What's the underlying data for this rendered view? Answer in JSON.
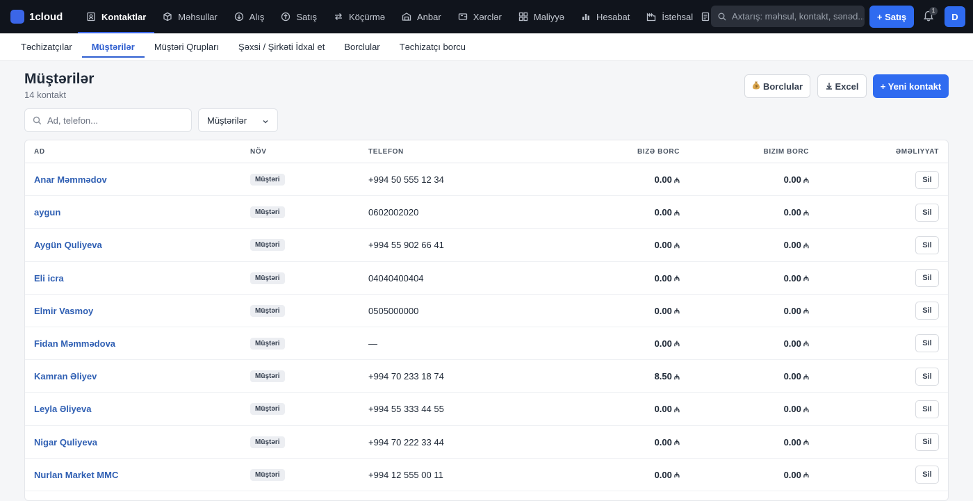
{
  "app": {
    "name": "1cloud"
  },
  "nav": [
    {
      "label": "Kontaktlar",
      "icon": "contacts-icon",
      "active": true
    },
    {
      "label": "Məhsullar",
      "icon": "box-icon"
    },
    {
      "label": "Alış",
      "icon": "arrow-down-circle-icon"
    },
    {
      "label": "Satış",
      "icon": "arrow-up-circle-icon"
    },
    {
      "label": "Köçürmə",
      "icon": "transfer-icon"
    },
    {
      "label": "Anbar",
      "icon": "warehouse-icon"
    },
    {
      "label": "Xərclər",
      "icon": "wallet-icon"
    },
    {
      "label": "Maliyyə",
      "icon": "grid-icon"
    },
    {
      "label": "Hesabat",
      "icon": "bar-chart-icon"
    },
    {
      "label": "İstehsal",
      "icon": "factory-icon"
    }
  ],
  "topbar": {
    "search_placeholder": "Axtarış: məhsul, kontakt, sənəd...",
    "sale_button": "+ Satış",
    "notifications_count": "1",
    "avatar_initial": "D"
  },
  "subtabs": [
    {
      "label": "Təchizatçılar"
    },
    {
      "label": "Müştərilər",
      "active": true
    },
    {
      "label": "Müştəri Qrupları"
    },
    {
      "label": "Şəxsi / Şirkəti İdxal et"
    },
    {
      "label": "Borclular"
    },
    {
      "label": "Təchizatçı borcu"
    }
  ],
  "page": {
    "title": "Müştərilər",
    "subtitle": "14 kontakt",
    "buttons": {
      "debtors": "Borclular",
      "debtors_icon": "money-bag-icon",
      "excel": "Excel",
      "new_contact": "+ Yeni kontakt"
    }
  },
  "filters": {
    "search_placeholder": "Ad, telefon...",
    "type_selected": "Müştərilər"
  },
  "table": {
    "columns": {
      "name": "Ad",
      "type": "Növ",
      "phone": "Telefon",
      "owed_to_us": "Bizə borc",
      "our_debt": "Bizim borc",
      "actions": "Əməliyyat"
    },
    "currency": "₼",
    "delete_label": "Sil",
    "rows": [
      {
        "name": "Anar Məmmədov",
        "type": "Müştəri",
        "phone": "+994 50 555 12 34",
        "owed_to_us": "0.00",
        "our_debt": "0.00"
      },
      {
        "name": "aygun",
        "type": "Müştəri",
        "phone": "0602002020",
        "owed_to_us": "0.00",
        "our_debt": "0.00"
      },
      {
        "name": "Aygün Quliyeva",
        "type": "Müştəri",
        "phone": "+994 55 902 66 41",
        "owed_to_us": "0.00",
        "our_debt": "0.00"
      },
      {
        "name": "Eli icra",
        "type": "Müştəri",
        "phone": "04040400404",
        "owed_to_us": "0.00",
        "our_debt": "0.00"
      },
      {
        "name": "Elmir Vasmoy",
        "type": "Müştəri",
        "phone": "0505000000",
        "owed_to_us": "0.00",
        "our_debt": "0.00"
      },
      {
        "name": "Fidan Məmmədova",
        "type": "Müştəri",
        "phone": "—",
        "owed_to_us": "0.00",
        "our_debt": "0.00"
      },
      {
        "name": "Kamran Əliyev",
        "type": "Müştəri",
        "phone": "+994 70 233 18 74",
        "owed_to_us": "8.50",
        "our_debt": "0.00"
      },
      {
        "name": "Leyla Əliyeva",
        "type": "Müştəri",
        "phone": "+994 55 333 44 55",
        "owed_to_us": "0.00",
        "our_debt": "0.00"
      },
      {
        "name": "Nigar Quliyeva",
        "type": "Müştəri",
        "phone": "+994 70 222 33 44",
        "owed_to_us": "0.00",
        "our_debt": "0.00"
      },
      {
        "name": "Nurlan Market MMC",
        "type": "Müştəri",
        "phone": "+994 12 555 00 11",
        "owed_to_us": "0.00",
        "our_debt": "0.00"
      }
    ]
  },
  "colors": {
    "accent": "#2f6bf0",
    "topbar_bg": "#10141c",
    "link": "#2f5fb3"
  }
}
